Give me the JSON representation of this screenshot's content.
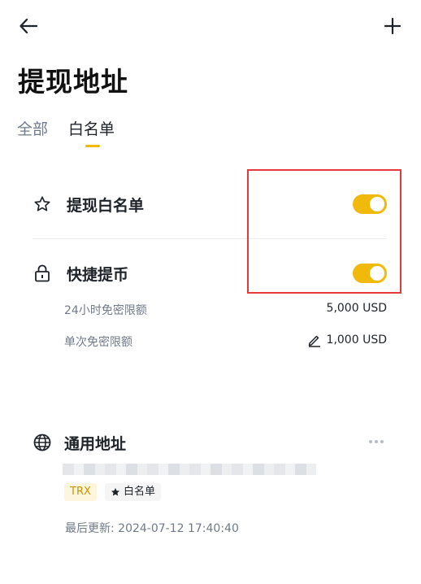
{
  "header": {
    "back_icon": "arrow-left-icon",
    "add_icon": "plus-icon"
  },
  "title": "提现地址",
  "tabs": [
    {
      "label": "全部",
      "active": false
    },
    {
      "label": "白名单",
      "active": true
    }
  ],
  "colors": {
    "accent": "#f0b90b",
    "highlight_box": "#e5393b",
    "muted_text": "#707a8a"
  },
  "settings": {
    "withdraw_whitelist": {
      "icon": "star-outline-icon",
      "label": "提现白名单",
      "enabled": true
    },
    "quick_withdraw": {
      "icon": "lock-icon",
      "label": "快捷提币",
      "enabled": true,
      "limits": [
        {
          "label": "24小时免密限额",
          "value": "5,000 USD",
          "editable": false
        },
        {
          "label": "单次免密限额",
          "value": "1,000 USD",
          "editable": true,
          "edit_icon": "pencil-icon"
        }
      ]
    }
  },
  "address_card": {
    "icon": "globe-icon",
    "title": "通用地址",
    "menu_icon": "more-dots-icon",
    "network_tag": "TRX",
    "whitelist_tag": "白名单",
    "whitelist_tag_icon": "star-filled-icon",
    "updated": "最后更新: 2024-07-12 17:40:40"
  }
}
